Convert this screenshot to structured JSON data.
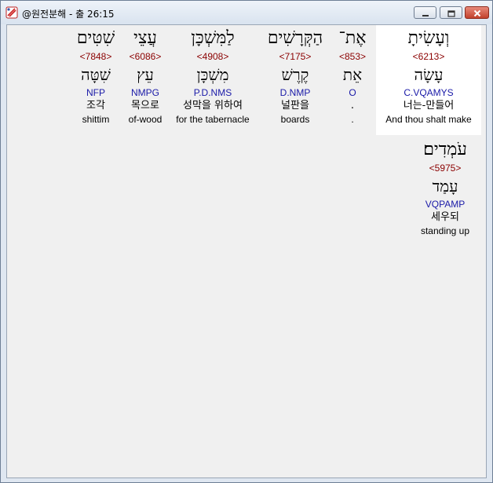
{
  "window": {
    "title": "@원전분해 - 출 26:15"
  },
  "words": [
    {
      "hebrew": "וְעָשִׂיתָ",
      "strong": "<6213>",
      "lemma": "עָשָׂה",
      "morph": "C.VQAMYS",
      "korean": "너는-만들어",
      "english": "And thou shalt make"
    },
    {
      "hebrew": "אֶת־",
      "strong": "<853>",
      "lemma": "אֵת",
      "morph": "O",
      "korean": ".",
      "english": "."
    },
    {
      "hebrew": "הַקְּרָשִׁים",
      "strong": "<7175>",
      "lemma": "קֶרֶשׁ",
      "morph": "D.NMP",
      "korean": "널판을",
      "english": "boards"
    },
    {
      "hebrew": "לַמִּשְׁכָּן",
      "strong": "<4908>",
      "lemma": "מִשְׁכָּן",
      "morph": "P.D.NMS",
      "korean": "성막을 위하여",
      "english": "for the tabernacle"
    },
    {
      "hebrew": "עֲצֵי",
      "strong": "<6086>",
      "lemma": "עֵץ",
      "morph": "NMPG",
      "korean": "목으로",
      "english": "of-wood"
    },
    {
      "hebrew": "שִׁטִּים",
      "strong": "<7848>",
      "lemma": "שִׁטָּה",
      "morph": "NFP",
      "korean": "조각",
      "english": "shittim"
    },
    {
      "hebrew": "עֹמְדִים׃",
      "strong": "<5975>",
      "lemma": "עָמַד",
      "morph": "VQPAMP",
      "korean": "세우되",
      "english": "standing up"
    }
  ],
  "colors": {
    "strong": "#8b0000",
    "morph": "#1a1aa8",
    "highlight": "#ffffff"
  },
  "icons": {
    "app": "app-icon",
    "min": "minimize-icon",
    "max": "maximize-icon",
    "close": "close-icon"
  }
}
